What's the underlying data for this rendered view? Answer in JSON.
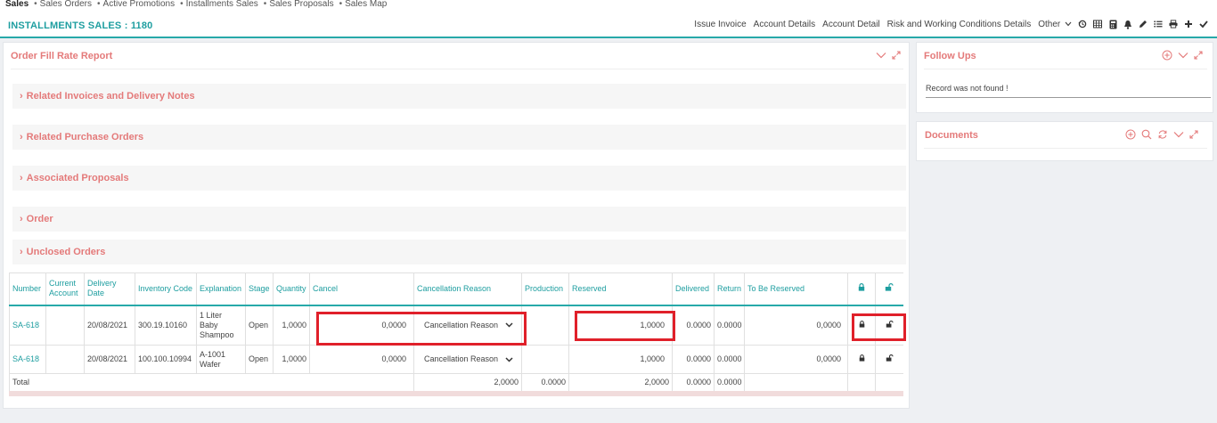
{
  "topnav": [
    "Sales",
    "Sales Orders",
    "Active Promotions",
    "Installments Sales",
    "Sales Proposals",
    "Sales Map"
  ],
  "header": {
    "title": "INSTALLMENTS SALES : 1180",
    "actions": [
      "Issue Invoice",
      "Account Details",
      "Account Detail",
      "Risk and Working Conditions Details",
      "Other"
    ],
    "icons": [
      "history-icon",
      "table-icon",
      "calculator-icon",
      "bell-icon",
      "pencil-icon",
      "list-icon",
      "print-icon",
      "plus-icon",
      "check-icon"
    ]
  },
  "main_panel": {
    "title": "Order Fill Rate Report",
    "sections": [
      "Related Invoices and Delivery Notes",
      "Related Purchase Orders",
      "Associated Proposals",
      "Order",
      "Unclosed Orders"
    ]
  },
  "table": {
    "columns": [
      "Number",
      "Current Account",
      "Delivery Date",
      "Inventory Code",
      "Explanation",
      "Stage",
      "Quantity",
      "Cancel",
      "Cancellation Reason",
      "Production",
      "Reserved",
      "Delivered",
      "Return",
      "To Be Reserved"
    ],
    "rows": [
      {
        "number": "SA-618",
        "account": "",
        "date": "20/08/2021",
        "code": "300.19.10160",
        "explanation": "1 Liter Baby Shampoo",
        "stage": "Open",
        "quantity": "1,0000",
        "cancel": "0,0000",
        "reason": "Cancellation Reason",
        "production": "",
        "reserved": "1,0000",
        "delivered": "0.0000",
        "return": "0.0000",
        "to_be_reserved": "0,0000"
      },
      {
        "number": "SA-618",
        "account": "",
        "date": "20/08/2021",
        "code": "100.100.10994",
        "explanation": "A-1001 Wafer",
        "stage": "Open",
        "quantity": "1,0000",
        "cancel": "0,0000",
        "reason": "Cancellation Reason",
        "production": "",
        "reserved": "1,0000",
        "delivered": "0.0000",
        "return": "0.0000",
        "to_be_reserved": "0,0000"
      }
    ],
    "total": {
      "label": "Total",
      "cancel": "2,0000",
      "production": "0.0000",
      "reserved": "2,0000",
      "delivered": "0.0000",
      "return": "0.0000"
    }
  },
  "follow_ups": {
    "title": "Follow Ups",
    "message": "Record was not found !"
  },
  "documents": {
    "title": "Documents"
  },
  "colors": {
    "accent": "#1e9ea0",
    "section_title": "#e47a7a",
    "highlight": "#e0202a"
  }
}
